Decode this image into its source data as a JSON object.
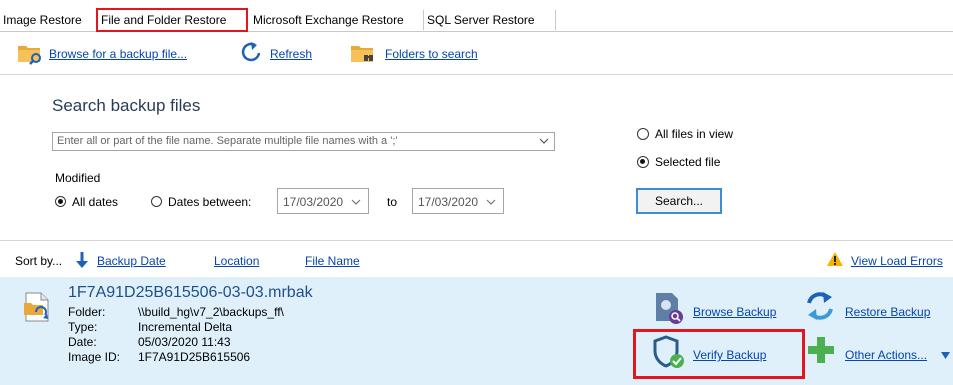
{
  "tabs": [
    {
      "label": "Image Restore",
      "active": false
    },
    {
      "label": "File and Folder Restore",
      "active": true
    },
    {
      "label": "Microsoft Exchange Restore",
      "active": false
    },
    {
      "label": "SQL Server Restore",
      "active": false
    }
  ],
  "toolbar": {
    "browse_label": "Browse for a backup file...",
    "refresh_label": "Refresh",
    "folders_label": "Folders to search"
  },
  "search": {
    "title": "Search backup files",
    "placeholder": "Enter all or part of the file name. Separate multiple file names with a ';'",
    "modified_label": "Modified",
    "all_dates_label": "All dates",
    "dates_between_label": "Dates between:",
    "date_from": "17/03/2020",
    "to_label": "to",
    "date_to": "17/03/2020",
    "all_files_label": "All files in view",
    "selected_file_label": "Selected file",
    "search_button": "Search..."
  },
  "sort": {
    "label": "Sort by...",
    "backup_date": "Backup Date",
    "location": "Location",
    "file_name": "File Name",
    "view_errors": "View Load Errors"
  },
  "result": {
    "file_name": "1F7A91D25B615506-03-03.mrbak",
    "folder_key": "Folder:",
    "folder_val": "\\\\build_hg\\v7_2\\backups_ff\\",
    "type_key": "Type:",
    "type_val": "Incremental Delta",
    "date_key": "Date:",
    "date_val": "05/03/2020 11:43",
    "imageid_key": "Image ID:",
    "imageid_val": "1F7A91D25B615506"
  },
  "actions": {
    "browse": "Browse Backup",
    "restore": "Restore Backup",
    "verify": "Verify Backup",
    "other": "Other Actions..."
  },
  "colors": {
    "link": "#0645ad",
    "highlight": "#e3151f",
    "result_bg": "#dff0fb"
  }
}
